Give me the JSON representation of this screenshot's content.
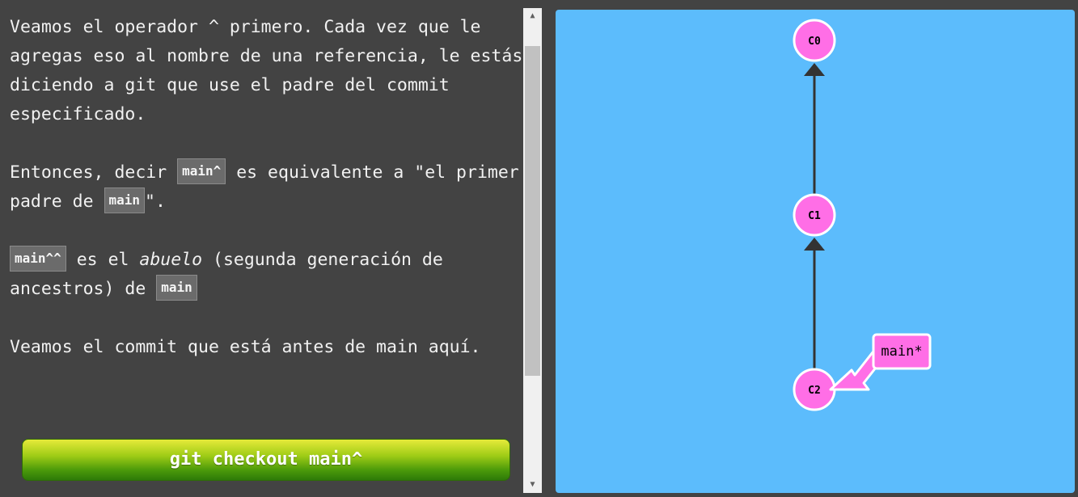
{
  "lesson": {
    "p1": "Veamos el operador ^ primero. Cada vez que le agregas eso al nombre de una referencia, le estás diciendo a git que use el padre del commit especificado.",
    "p2_before": "Entonces, decir ",
    "p2_code1": "main^",
    "p2_mid": " es equivalente a \"el primer padre de ",
    "p2_code2": "main",
    "p2_after": "\".",
    "p3_code1": "main^^",
    "p3_text1": " es el ",
    "p3_italic": "abuelo",
    "p3_text2": " (segunda generación de ancestros) de ",
    "p3_code2": "main",
    "p4": "Veamos el commit que está antes de main aquí."
  },
  "command_button": {
    "label": "git checkout main^"
  },
  "graph": {
    "commits": [
      {
        "id": "C0"
      },
      {
        "id": "C1"
      },
      {
        "id": "C2"
      }
    ],
    "branch": {
      "name": "main*",
      "target": "C2"
    },
    "colors": {
      "background": "#5cbcfc",
      "commit_fill": "#ff6ee6",
      "commit_stroke": "#ffffff",
      "edge": "#333333"
    }
  }
}
